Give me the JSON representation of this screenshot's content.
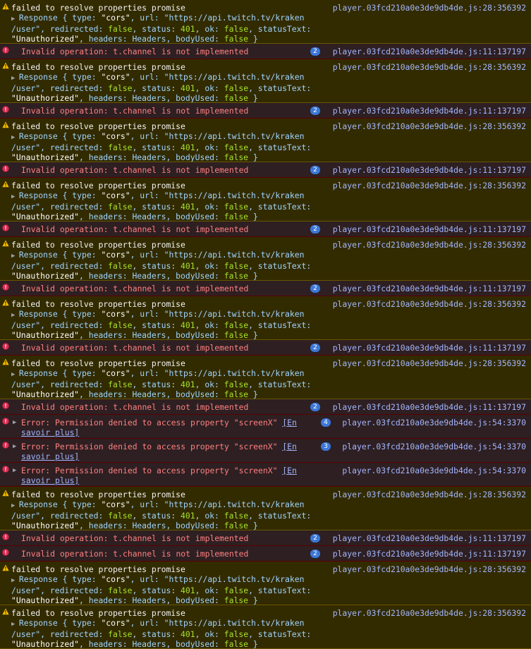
{
  "colors": {
    "warning_bg": "#332b00",
    "error_bg": "#2e1f22",
    "link": "#a2b6ff",
    "badge": "#3b78d9"
  },
  "icons": {
    "warning": "warning-triangle-icon",
    "error": "error-circle-icon",
    "expand": "disclosure-triangle-icon"
  },
  "templates": {
    "warn": {
      "message": "failed to resolve properties promise",
      "source": "player.03fcd210a0e3de9db4de.js:28:356392",
      "line1": "Response { type: \"cors\", url: \"https://api.twitch.tv/kraken",
      "line2": "/user\", redirected: false, status: 401, ok: false, statusText:",
      "line3": "\"Unauthorized\", headers: Headers, bodyUsed: false }"
    },
    "chan": {
      "message": "Invalid operation: t.channel is not implemented",
      "source": "player.03fcd210a0e3de9db4de.js:11:137197",
      "count": "2"
    },
    "perm": {
      "message": "Error: Permission denied to access property \"screenX\"",
      "link_a": "[En",
      "link_b": "savoir plus]",
      "source": "player.03fcd210a0e3de9db4de.js:54:3370"
    }
  },
  "entries": [
    {
      "kind": "warn",
      "h": 62
    },
    {
      "kind": "chan",
      "h": 22
    },
    {
      "kind": "warn",
      "h": 62
    },
    {
      "kind": "chan",
      "h": 22
    },
    {
      "kind": "warn",
      "h": 62
    },
    {
      "kind": "chan",
      "h": 22
    },
    {
      "kind": "warn",
      "h": 62
    },
    {
      "kind": "chan",
      "h": 22
    },
    {
      "kind": "warn",
      "h": 62
    },
    {
      "kind": "chan",
      "h": 22
    },
    {
      "kind": "warn",
      "h": 62
    },
    {
      "kind": "chan",
      "h": 22
    },
    {
      "kind": "warn",
      "h": 62
    },
    {
      "kind": "chan",
      "h": 22
    },
    {
      "kind": "perm",
      "h": 34,
      "count": "4"
    },
    {
      "kind": "perm",
      "h": 34,
      "count": "3"
    },
    {
      "kind": "perm",
      "h": 34,
      "count": ""
    },
    {
      "kind": "warn",
      "h": 62
    },
    {
      "kind": "chan",
      "h": 22
    },
    {
      "kind": "chan",
      "h": 22
    },
    {
      "kind": "warn",
      "h": 62
    },
    {
      "kind": "warn",
      "h": 62
    }
  ]
}
